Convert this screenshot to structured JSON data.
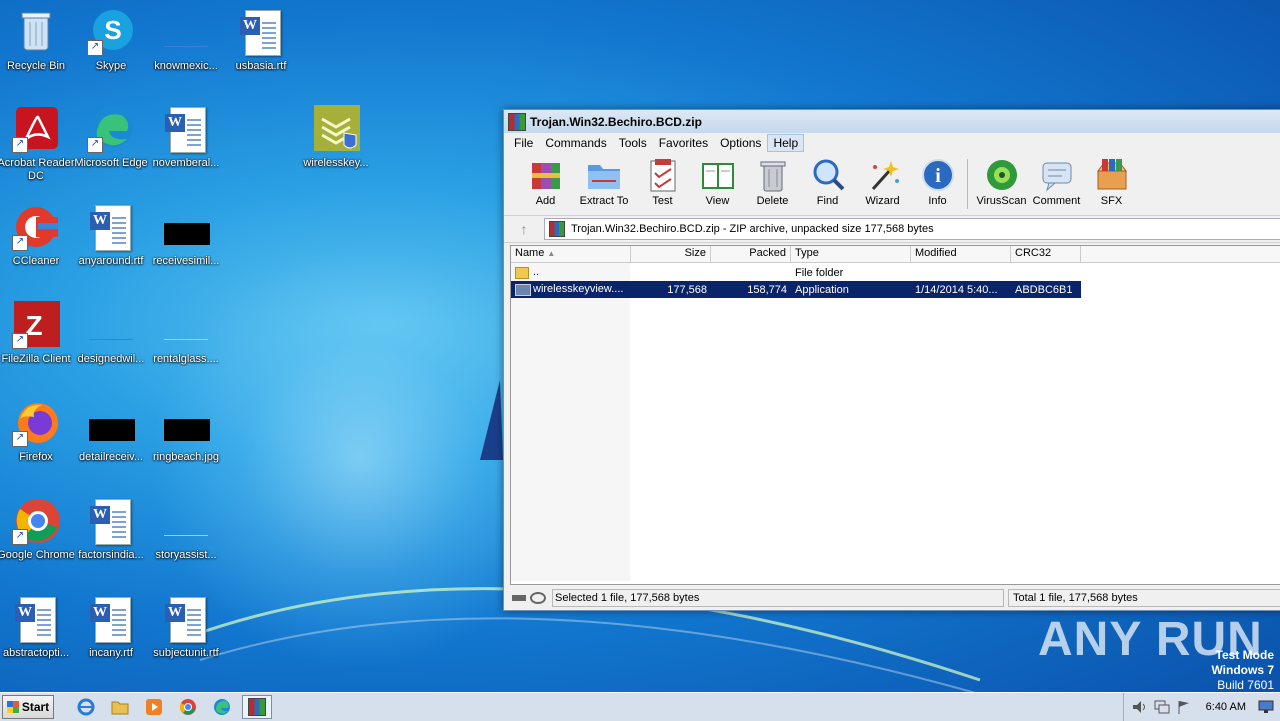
{
  "desktop": {
    "icons": [
      {
        "label": "Recycle Bin"
      },
      {
        "label": "Skype"
      },
      {
        "label": "knowmexic..."
      },
      {
        "label": "usbasia.rtf"
      },
      {
        "label": "Acrobat Reader DC"
      },
      {
        "label": "Microsoft Edge"
      },
      {
        "label": "novemberal..."
      },
      {
        "label": "wirelesskey..."
      },
      {
        "label": "CCleaner"
      },
      {
        "label": "anyaround.rtf"
      },
      {
        "label": "receivesimil..."
      },
      {
        "label": "FileZilla Client"
      },
      {
        "label": "designedwil..."
      },
      {
        "label": "rentalglass...."
      },
      {
        "label": "Firefox"
      },
      {
        "label": "detailreceiv..."
      },
      {
        "label": "ringbeach.jpg"
      },
      {
        "label": "Google Chrome"
      },
      {
        "label": "factorsindia..."
      },
      {
        "label": "storyassist..."
      },
      {
        "label": "abstractopti..."
      },
      {
        "label": "incany.rtf"
      },
      {
        "label": "subjectunit.rtf"
      }
    ]
  },
  "window": {
    "title": "Trojan.Win32.Bechiro.BCD.zip",
    "menu": [
      "File",
      "Commands",
      "Tools",
      "Favorites",
      "Options",
      "Help"
    ],
    "toolbar": [
      "Add",
      "Extract To",
      "Test",
      "View",
      "Delete",
      "Find",
      "Wizard",
      "Info",
      "VirusScan",
      "Comment",
      "SFX"
    ],
    "address": "Trojan.Win32.Bechiro.BCD.zip - ZIP archive, unpacked size 177,568 bytes",
    "columns": [
      "Name",
      "Size",
      "Packed",
      "Type",
      "Modified",
      "CRC32"
    ],
    "rows": [
      {
        "name": "..",
        "size": "",
        "packed": "",
        "type": "File folder",
        "modified": "",
        "crc": ""
      },
      {
        "name": "wirelesskeyview....",
        "size": "177,568",
        "packed": "158,774",
        "type": "Application",
        "modified": "1/14/2014 5:40...",
        "crc": "ABDBC6B1"
      }
    ],
    "status_left": "Selected 1 file, 177,568 bytes",
    "status_right": "Total 1 file, 177,568 bytes"
  },
  "taskbar": {
    "start_label": "Start",
    "clock": "6:40 AM"
  },
  "overlay": {
    "watermark": "ANY RUN",
    "test_mode": "Test Mode",
    "os_name": "Windows 7",
    "build": "Build 7601"
  },
  "colors": {
    "selection": "#0a246a",
    "desktop_blue": "#1277cf"
  }
}
